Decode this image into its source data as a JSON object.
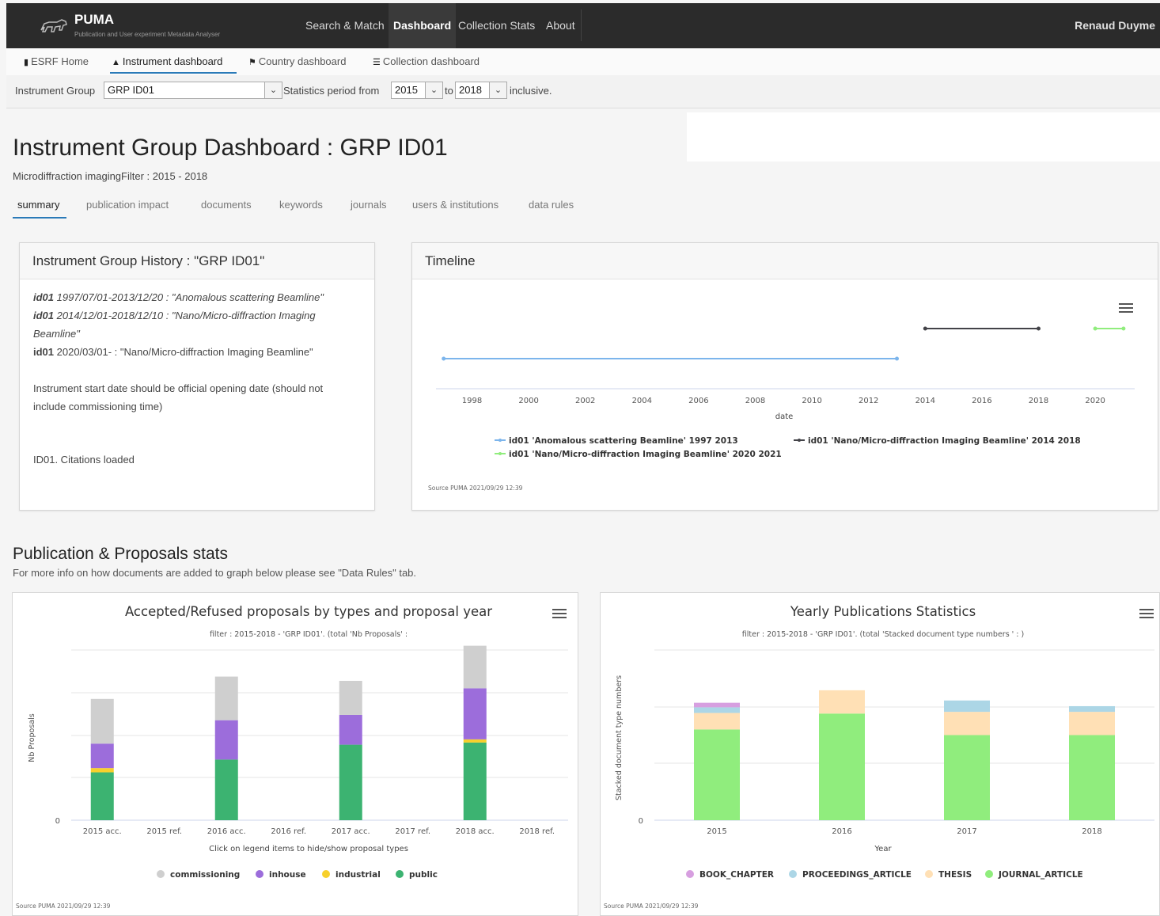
{
  "app": {
    "title": "PUMA",
    "subtitle": "Publication and User experiment Metadata Analyser",
    "nav": [
      {
        "label": "Search & Match"
      },
      {
        "label": "Dashboard"
      },
      {
        "label": "Collection Stats"
      },
      {
        "label": "About"
      }
    ],
    "user": "Renaud Duyme"
  },
  "subnav": {
    "items": [
      {
        "label": "ESRF Home"
      },
      {
        "label": "Instrument dashboard"
      },
      {
        "label": "Country dashboard"
      },
      {
        "label": "Collection dashboard"
      }
    ]
  },
  "filter": {
    "group_label": "Instrument Group",
    "group_value": "GRP ID01",
    "period_label": "Statistics period from",
    "from_value": "2015",
    "to_label": "to",
    "to_value": "2018",
    "suffix": "inclusive."
  },
  "page": {
    "title": "Instrument Group Dashboard : GRP ID01",
    "subtitle": "Microdiffraction imagingFilter : 2015 - 2018",
    "tabs": [
      {
        "label": "summary"
      },
      {
        "label": "publication impact"
      },
      {
        "label": "documents"
      },
      {
        "label": "keywords"
      },
      {
        "label": "journals"
      },
      {
        "label": "users & institutions"
      },
      {
        "label": "data rules"
      }
    ]
  },
  "history": {
    "title": "Instrument Group History : \"GRP ID01\"",
    "entries": [
      {
        "code": "id01",
        "text": " 1997/07/01-2013/12/20 : \"Anomalous scattering Beamline\""
      },
      {
        "code": "id01",
        "text": " 2014/12/01-2018/12/10 : \"Nano/Micro-diffraction Imaging"
      },
      {
        "cont": "Beamline\""
      },
      {
        "code": "id01",
        "text": " 2020/03/01- : \"Nano/Micro-diffraction Imaging Beamline\""
      }
    ],
    "note_line1": "Instrument start date should be official opening date (should not",
    "note_line2": "include commissioning time)",
    "citations": "ID01. Citations loaded"
  },
  "timeline": {
    "title": "Timeline",
    "xlabel": "date",
    "ticks": [
      "1998",
      "2000",
      "2002",
      "2004",
      "2006",
      "2008",
      "2010",
      "2012",
      "2014",
      "2016",
      "2018",
      "2020"
    ],
    "legend": [
      {
        "label": "id01 'Anomalous scattering Beamline' 1997 2013",
        "color": "#7cb5ec"
      },
      {
        "label": "id01 'Nano/Micro-diffraction Imaging Beamline' 2014 2018",
        "color": "#434348"
      },
      {
        "label": "id01 'Nano/Micro-diffraction Imaging Beamline' 2020 2021",
        "color": "#90ed7d"
      }
    ],
    "source": "Source PUMA 2021/09/29 12:39"
  },
  "pubs_section": {
    "title": "Publication & Proposals stats",
    "subtitle": "For more info on how documents are added to graph below please see \"Data Rules\" tab."
  },
  "proposals_chart": {
    "title": "Accepted/Refused proposals by types and proposal year",
    "subtitle": "filter : 2015-2018 - 'GRP ID01'. (total 'Nb Proposals' :",
    "ylabel": "Nb Proposals",
    "xnote": "Click on legend items to hide/show proposal types",
    "source": "Source PUMA 2021/09/29 12:39"
  },
  "yearly_chart": {
    "title": "Yearly Publications Statistics",
    "subtitle": "filter : 2015-2018 - 'GRP ID01'. (total 'Stacked document type numbers ' :     )",
    "ylabel": "Stacked document type numbers",
    "source": "Source PUMA 2021/09/29 12:39"
  },
  "chart_data": [
    {
      "type": "line",
      "title": "Timeline",
      "xlabel": "date",
      "xlim": [
        1996,
        2021.5
      ],
      "series": [
        {
          "name": "id01 'Anomalous scattering Beamline' 1997 2013",
          "x": [
            1997,
            2013
          ],
          "color": "#7cb5ec"
        },
        {
          "name": "id01 'Nano/Micro-diffraction Imaging Beamline' 2014 2018",
          "x": [
            2014,
            2018
          ],
          "color": "#434348"
        },
        {
          "name": "id01 'Nano/Micro-diffraction Imaging Beamline' 2020 2021",
          "x": [
            2020,
            2021
          ],
          "color": "#90ed7d"
        }
      ]
    },
    {
      "type": "bar",
      "title": "Accepted/Refused proposals by types and proposal year",
      "categories": [
        "2015 acc.",
        "2015 ref.",
        "2016 acc.",
        "2016 ref.",
        "2017 acc.",
        "2017 ref.",
        "2018 acc.",
        "2018 ref."
      ],
      "ylabel": "Nb Proposals",
      "ylim": [
        0,
        16
      ],
      "series": [
        {
          "name": "public",
          "color": "#3cb371",
          "values": [
            4.5,
            0,
            5.7,
            0,
            7.1,
            0,
            7.3,
            0
          ]
        },
        {
          "name": "industrial",
          "color": "#f7d02c",
          "values": [
            0.4,
            0,
            0,
            0,
            0,
            0,
            0.3,
            0
          ]
        },
        {
          "name": "inhouse",
          "color": "#9c6ddb",
          "values": [
            2.3,
            0,
            3.7,
            0,
            2.8,
            0,
            4.8,
            0
          ]
        },
        {
          "name": "commissioning",
          "color": "#cfcfcf",
          "values": [
            4.2,
            0,
            4.1,
            0,
            3.2,
            0,
            4.0,
            0
          ]
        }
      ]
    },
    {
      "type": "bar",
      "title": "Yearly Publications Statistics",
      "categories": [
        "2015",
        "2016",
        "2017",
        "2018"
      ],
      "xlabel": "Year",
      "ylabel": "Stacked document type numbers",
      "ylim": [
        0,
        30
      ],
      "series": [
        {
          "name": "JOURNAL_ARTICLE",
          "color": "#90ed7d",
          "values": [
            16.0,
            18.8,
            15.0,
            15.0
          ]
        },
        {
          "name": "THESIS",
          "color": "#ffe0b5",
          "values": [
            2.9,
            4.1,
            4.1,
            4.1
          ]
        },
        {
          "name": "PROCEEDINGS_ARTICLE",
          "color": "#acd6e6",
          "values": [
            1.0,
            0,
            2.0,
            1.0
          ]
        },
        {
          "name": "BOOK_CHAPTER",
          "color": "#d79fe0",
          "values": [
            0.8,
            0,
            0,
            0
          ]
        }
      ]
    }
  ]
}
